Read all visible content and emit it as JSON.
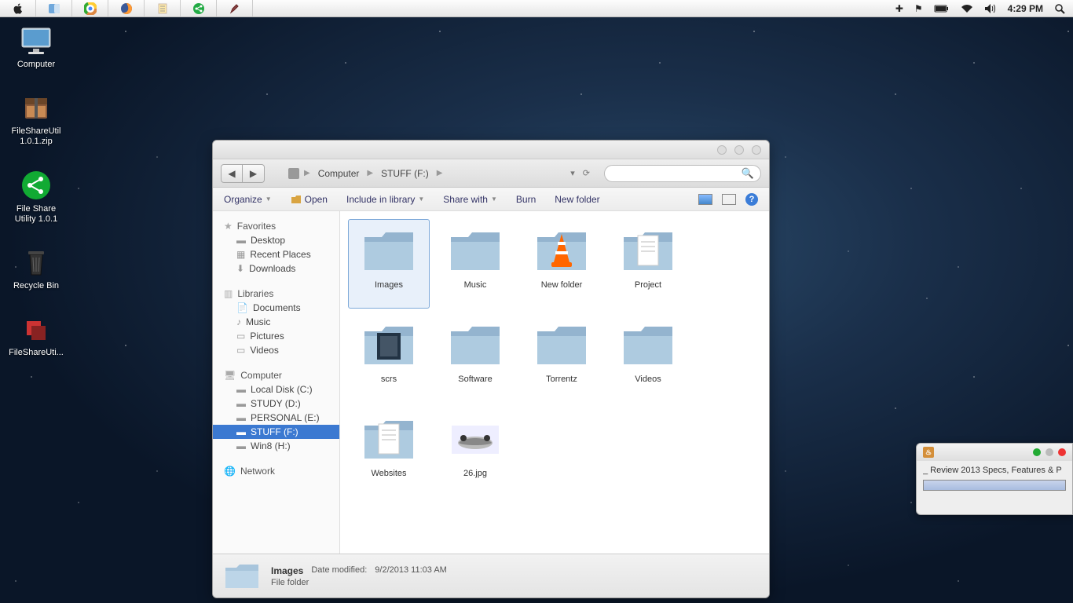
{
  "menubar": {
    "clock": "4:29 PM"
  },
  "desktop_icons": [
    {
      "name": "Computer",
      "icon": "monitor"
    },
    {
      "name": "FileShareUtil 1.0.1.zip",
      "icon": "archive"
    },
    {
      "name": "File Share Utility 1.0.1",
      "icon": "share"
    },
    {
      "name": "Recycle Bin",
      "icon": "trash"
    },
    {
      "name": "FileShareUti...",
      "icon": "app"
    }
  ],
  "explorer": {
    "breadcrumb": {
      "root": "Computer",
      "current": "STUFF (F:)"
    },
    "toolbar": {
      "organize": "Organize",
      "open": "Open",
      "include": "Include in library",
      "share": "Share with",
      "burn": "Burn",
      "newfolder": "New folder"
    },
    "sidebar": {
      "favorites": {
        "label": "Favorites",
        "items": [
          "Desktop",
          "Recent Places",
          "Downloads"
        ]
      },
      "libraries": {
        "label": "Libraries",
        "items": [
          "Documents",
          "Music",
          "Pictures",
          "Videos"
        ]
      },
      "computer": {
        "label": "Computer",
        "items": [
          "Local Disk (C:)",
          "STUDY (D:)",
          "PERSONAL (E:)",
          "STUFF (F:)",
          "Win8 (H:)"
        ]
      },
      "network": {
        "label": "Network"
      }
    },
    "items": [
      {
        "name": "Images",
        "type": "folder",
        "selected": true
      },
      {
        "name": "Music",
        "type": "folder"
      },
      {
        "name": "New folder",
        "type": "vlc-folder"
      },
      {
        "name": "Project",
        "type": "doc-folder"
      },
      {
        "name": "scrs",
        "type": "thumb-folder"
      },
      {
        "name": "Software",
        "type": "folder"
      },
      {
        "name": "Torrentz",
        "type": "folder"
      },
      {
        "name": "Videos",
        "type": "folder"
      },
      {
        "name": "Websites",
        "type": "doc-folder"
      },
      {
        "name": "26.jpg",
        "type": "image"
      }
    ],
    "status": {
      "name": "Images",
      "type": "File folder",
      "date_label": "Date modified:",
      "date": "9/2/2013 11:03 AM"
    }
  },
  "progress": {
    "text": "_ Review 2013 Specs, Features & P"
  }
}
